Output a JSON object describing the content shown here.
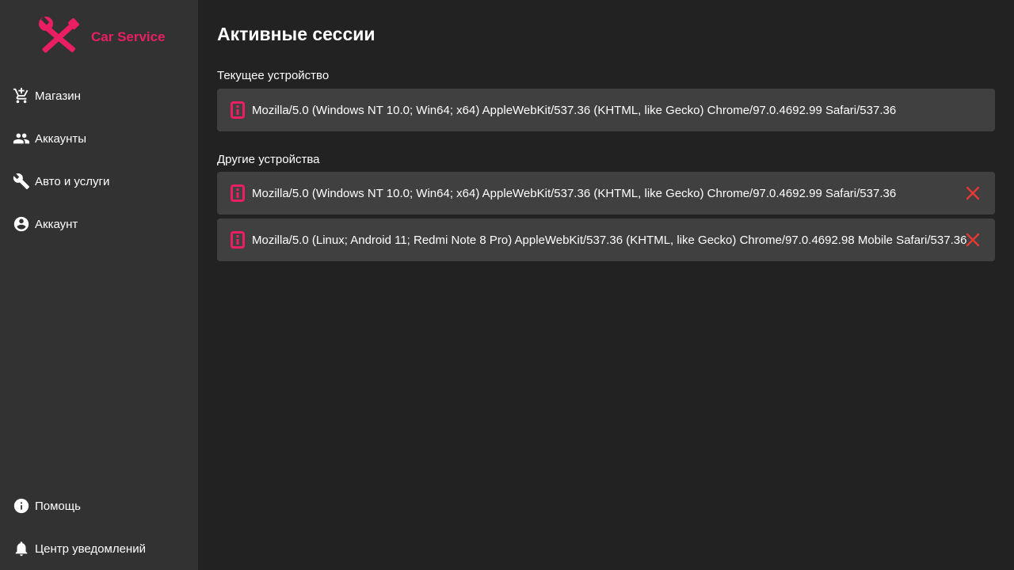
{
  "brand": {
    "name": "Car Service",
    "accent_color": "#e91e63",
    "icon": "tools-icon"
  },
  "sidebar": {
    "items": [
      {
        "label": "Магазин",
        "icon": "cart-icon"
      },
      {
        "label": "Аккаунты",
        "icon": "people-icon"
      },
      {
        "label": "Авто и услуги",
        "icon": "wrench-icon"
      },
      {
        "label": "Аккаунт",
        "icon": "account-circle-icon"
      }
    ],
    "bottom_items": [
      {
        "label": "Помощь",
        "icon": "info-icon"
      },
      {
        "label": "Центр уведомлений",
        "icon": "bell-icon"
      }
    ]
  },
  "main": {
    "title": "Активные сессии",
    "current_section": "Текущее устройство",
    "current_session": {
      "user_agent": "Mozilla/5.0 (Windows NT 10.0; Win64; x64) AppleWebKit/537.36 (KHTML, like Gecko) Chrome/97.0.4692.99 Safari/537.36",
      "icon": "device-icon"
    },
    "other_section": "Другие устройства",
    "other_sessions": [
      {
        "user_agent": "Mozilla/5.0 (Windows NT 10.0; Win64; x64) AppleWebKit/537.36 (KHTML, like Gecko) Chrome/97.0.4692.99 Safari/537.36",
        "icon": "device-icon",
        "close_icon": "close-icon"
      },
      {
        "user_agent": "Mozilla/5.0 (Linux; Android 11; Redmi Note 8 Pro) AppleWebKit/537.36 (KHTML, like Gecko) Chrome/97.0.4692.98 Mobile Safari/537.36",
        "icon": "device-icon",
        "close_icon": "close-icon"
      }
    ]
  },
  "colors": {
    "sidebar_bg": "#323232",
    "main_bg": "#222222",
    "card_bg": "#404040",
    "close_red": "#e53935"
  }
}
